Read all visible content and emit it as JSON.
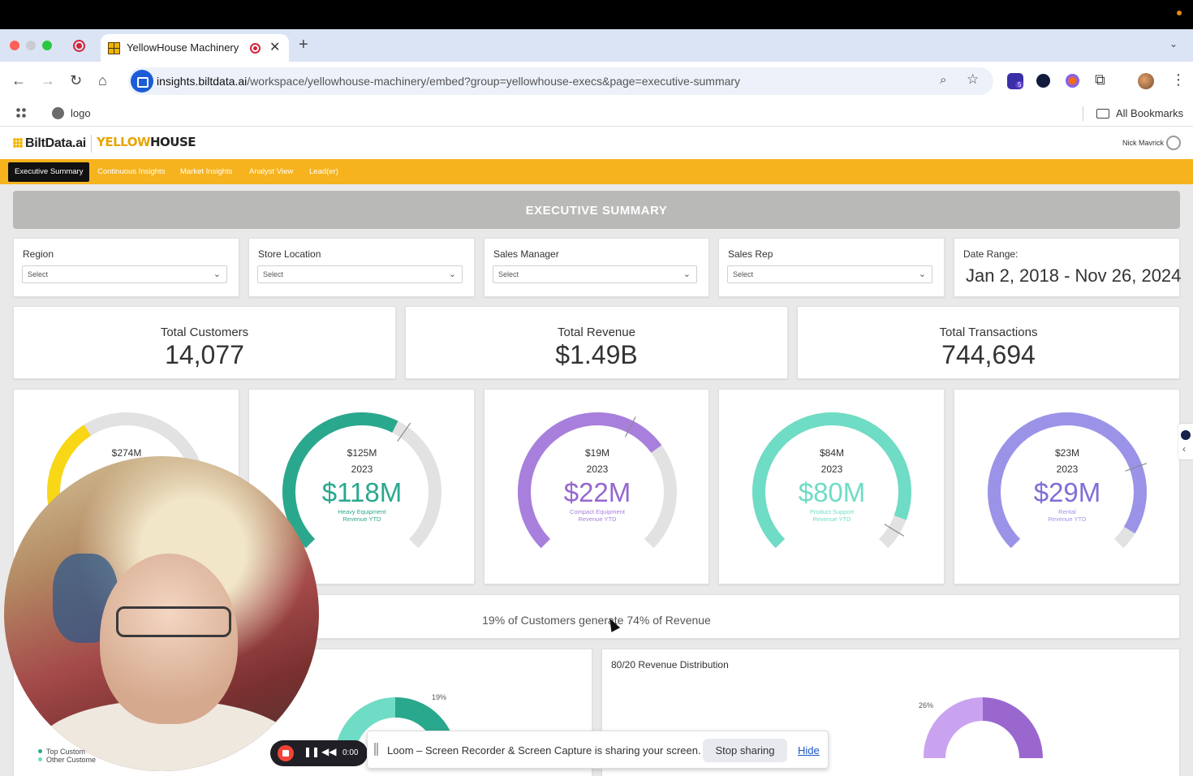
{
  "browser": {
    "tab_title": "YellowHouse Machinery",
    "url_host": "insights.biltdata.ai",
    "url_path": "/workspace/yellowhouse-machinery/embed?group=yellowhouse-execs&page=executive-summary",
    "bookmark_logo": "logo",
    "all_bookmarks": "All Bookmarks",
    "extension_badge": "5"
  },
  "app": {
    "brand_left": "BiltData.ai",
    "brand_right_a": "YELLOW",
    "brand_right_b": "HOUSE",
    "user_name": "Nick Mavrick",
    "nav": [
      "Executive Summary",
      "Continuous Insights",
      "Market Insights",
      "Analyst View",
      "Lead(er)"
    ],
    "page_title": "EXECUTIVE SUMMARY"
  },
  "filters": [
    {
      "label": "Region",
      "placeholder": "Select"
    },
    {
      "label": "Store Location",
      "placeholder": "Select"
    },
    {
      "label": "Sales Manager",
      "placeholder": "Select"
    },
    {
      "label": "Sales Rep",
      "placeholder": "Select"
    }
  ],
  "date_range": {
    "label": "Date Range:",
    "value": "Jan 2, 2018 - Nov 26, 2024"
  },
  "kpis": [
    {
      "label": "Total Customers",
      "value": "14,077"
    },
    {
      "label": "Total Revenue",
      "value": "$1.49B"
    },
    {
      "label": "Total Transactions",
      "value": "744,694"
    }
  ],
  "gauges": [
    {
      "target": "$274M",
      "year": "",
      "value": "",
      "label1": "",
      "label2": "",
      "fraction": 0.38,
      "marker": null,
      "color": "#f7d716"
    },
    {
      "target": "$125M",
      "year": "2023",
      "value": "$118M",
      "label1": "Heavy Equipment",
      "label2": "Revenue YTD",
      "fraction": 0.6,
      "marker": 0.63,
      "color": "#2aa88d"
    },
    {
      "target": "$19M",
      "year": "2023",
      "value": "$22M",
      "label1": "Compact Equipment",
      "label2": "Revenue YTD",
      "fraction": 0.7,
      "marker": 0.6,
      "color": "#a87fdc"
    },
    {
      "target": "$84M",
      "year": "2023",
      "value": "$80M",
      "label1": "Product Support",
      "label2": "Revenue YTD",
      "fraction": 0.91,
      "marker": 0.95,
      "color": "#6fdcc5"
    },
    {
      "target": "$23M",
      "year": "2023",
      "value": "$29M",
      "label1": "Rental",
      "label2": "Revenue YTD",
      "fraction": 0.95,
      "marker": 0.76,
      "color": "#9b93e8"
    }
  ],
  "insight": "19% of Customers generate 74% of Revenue",
  "bottom_left": {
    "pct_label": "19%",
    "legend": [
      "Top Custom",
      "Other Custome"
    ]
  },
  "bottom_right": {
    "title": "80/20 Revenue Distribution",
    "pct_label": "26%"
  },
  "loom": {
    "time": "0:00",
    "message": "Loom – Screen Recorder & Screen Capture is sharing your screen.",
    "stop": "Stop sharing",
    "hide": "Hide"
  }
}
